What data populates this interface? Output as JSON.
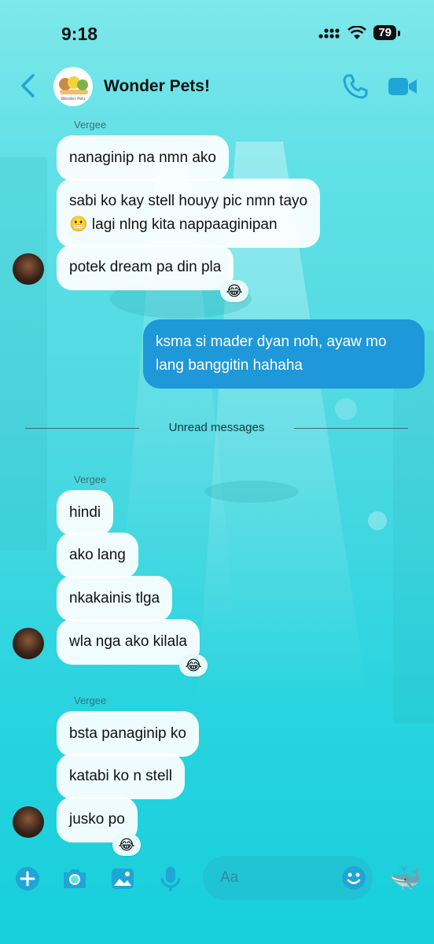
{
  "status": {
    "time": "9:18",
    "battery": "79"
  },
  "header": {
    "title": "Wonder Pets!",
    "avatar_text": "Wonder Pets"
  },
  "messages": {
    "group1": {
      "sender": "Vergee",
      "m1": "nanaginip na nmn ako",
      "m2_line1": "sabi ko kay stell houyy pic nmn tayo",
      "m2_line2": "😬 lagi nlng kita nappaaginipan",
      "m3": "potek dream pa din pla",
      "reaction": "😂"
    },
    "outgoing": {
      "line1": "ksma si mader dyan noh, ayaw mo",
      "line2": "lang banggitin hahaha"
    },
    "divider": "Unread messages",
    "group2": {
      "sender": "Vergee",
      "m1": "hindi",
      "m2": "ako lang",
      "m3": "nkakainis tlga",
      "m4": "wla nga ako kilala",
      "reaction": "😂"
    },
    "group3": {
      "sender": "Vergee",
      "m1": "bsta panaginip ko",
      "m2": "katabi ko n stell",
      "m3": "jusko po",
      "reaction": "😂"
    }
  },
  "composer": {
    "placeholder": "Aa",
    "quick_reaction": "🐳"
  },
  "colors": {
    "accent": "#1fa6d6",
    "outgoing_bubble": "#1f98d9"
  }
}
